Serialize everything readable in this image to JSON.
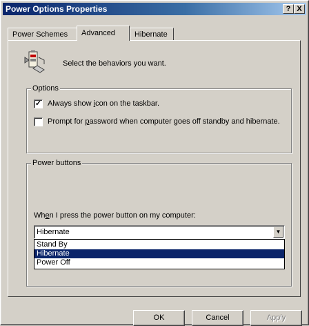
{
  "window": {
    "title": "Power Options Properties",
    "help_glyph": "?",
    "close_glyph": "X"
  },
  "tabs": [
    {
      "label": "Power Schemes"
    },
    {
      "label": "Advanced"
    },
    {
      "label": "Hibernate"
    }
  ],
  "advanced": {
    "intro": "Select the behaviors you want.",
    "options_group": "Options",
    "always_show_icon": {
      "pre": "Always show ",
      "accel": "i",
      "post": "con on the taskbar.",
      "checked": true
    },
    "prompt_password": {
      "pre": "Prompt for ",
      "accel": "p",
      "post": "assword when computer goes off standby and hibernate.",
      "checked": false
    },
    "power_buttons_group": "Power buttons",
    "power_button_label": {
      "pre": "Wh",
      "accel": "e",
      "post": "n I press the power button on my computer:"
    },
    "power_button_value": "Hibernate",
    "power_button_options": [
      "Stand By",
      "Hibernate",
      "Power Off"
    ],
    "selected_option_index": 1
  },
  "buttons": {
    "ok": "OK",
    "cancel": "Cancel",
    "apply": "Apply"
  }
}
